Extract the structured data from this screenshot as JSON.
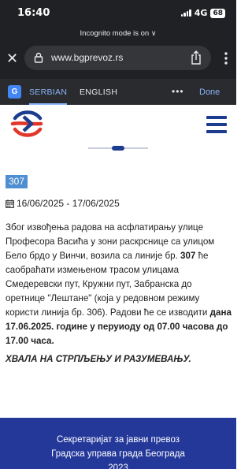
{
  "status_bar": {
    "time": "16:40",
    "network": "4G",
    "battery": "68"
  },
  "browser": {
    "mode_label": "Incognito mode is on",
    "url": "www.bgprevoz.rs"
  },
  "translate_bar": {
    "source_lang": "SERBIAN",
    "target_lang": "ENGLISH",
    "more": "•••",
    "done": "Done"
  },
  "article": {
    "line_badge": "307",
    "date_range": "16/06/2025 - 17/06/2025",
    "para_a": "Због извођења радова на асфлатирању улице Професора Васића у зони раскрснице са улицом Бело брдо у Винчи, возила са линије бр. ",
    "para_line": "307",
    "para_b": " ће саобраћати измењеном трасом улицама Смедеревски пут, Кружни пут, Забранска до оретнице \"Лештане\" (која у редовном режиму користи линија бр. 306). Радови ће се изводити ",
    "para_bold": "дана 17.06.2025. године у перуиоду од 07.00 часова до 17.00 часа.",
    "closing": "ХВАЛА НА СТРПЉЕЊУ И РАЗУМЕВАЊУ."
  },
  "footer": {
    "line1": "Секретаријат за јавни превоз",
    "line2": "Градска управа града Београда",
    "line3": "2023"
  },
  "colors": {
    "brand_blue": "#1b3c8f",
    "brand_red": "#e1372b",
    "footer_bg": "#24389a",
    "badge_bg": "#4f8ed1"
  },
  "icons": [
    "incognito-chevron-icon",
    "close-icon",
    "lock-icon",
    "share-icon",
    "overflow-menu-icon",
    "google-translate-icon",
    "bgprevoz-logo",
    "hamburger-menu-icon",
    "calendar-icon"
  ]
}
